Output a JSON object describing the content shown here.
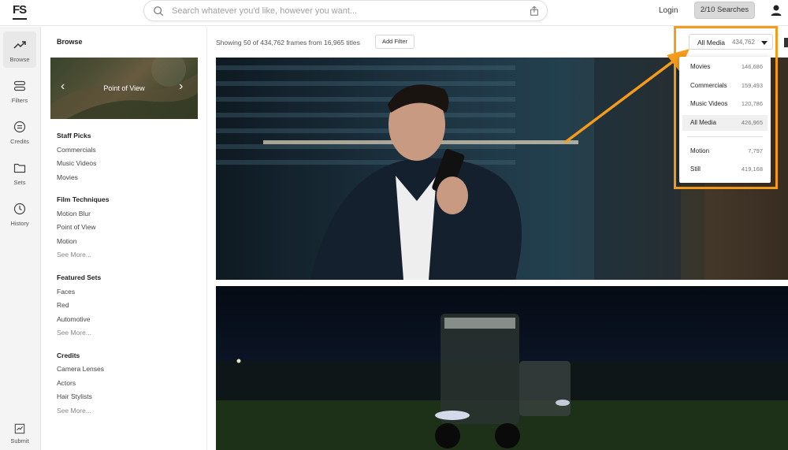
{
  "brand": {
    "logo": "FS"
  },
  "header": {
    "search_placeholder": "Search whatever you'd like, however you want...",
    "login": "Login",
    "searches": "2/10 Searches"
  },
  "rail": {
    "items": [
      {
        "label": "Browse",
        "icon": "trend-icon"
      },
      {
        "label": "Filters",
        "icon": "filters-icon"
      },
      {
        "label": "Credits",
        "icon": "credits-icon"
      },
      {
        "label": "Sets",
        "icon": "folder-icon"
      },
      {
        "label": "History",
        "icon": "history-icon"
      }
    ],
    "submit": "Submit"
  },
  "browse": {
    "title": "Browse",
    "hero_label": "Point of View",
    "sections": [
      {
        "title": "Staff Picks",
        "links": [
          "Commercials",
          "Music Videos",
          "Movies"
        ]
      },
      {
        "title": "Film Techniques",
        "links": [
          "Motion Blur",
          "Point of View",
          "Motion",
          "See More..."
        ]
      },
      {
        "title": "Featured Sets",
        "links": [
          "Faces",
          "Red",
          "Automotive",
          "See More..."
        ]
      },
      {
        "title": "Credits",
        "links": [
          "Camera Lenses",
          "Actors",
          "Hair Stylists",
          "See More..."
        ]
      }
    ]
  },
  "main": {
    "count_text": "Showing 50 of 434,762 frames from 16,965 titles",
    "add_filter": "Add Filter"
  },
  "dropdown": {
    "selected_label": "All Media",
    "selected_count": "434,762",
    "options": [
      {
        "name": "Movies",
        "count": "146,686"
      },
      {
        "name": "Commercials",
        "count": "159,493"
      },
      {
        "name": "Music Videos",
        "count": "120,786"
      },
      {
        "name": "All Media",
        "count": "426,965"
      },
      {
        "name": "Motion",
        "count": "7,797"
      },
      {
        "name": "Still",
        "count": "419,168"
      }
    ]
  },
  "colors": {
    "highlight": "#f59c1a"
  }
}
